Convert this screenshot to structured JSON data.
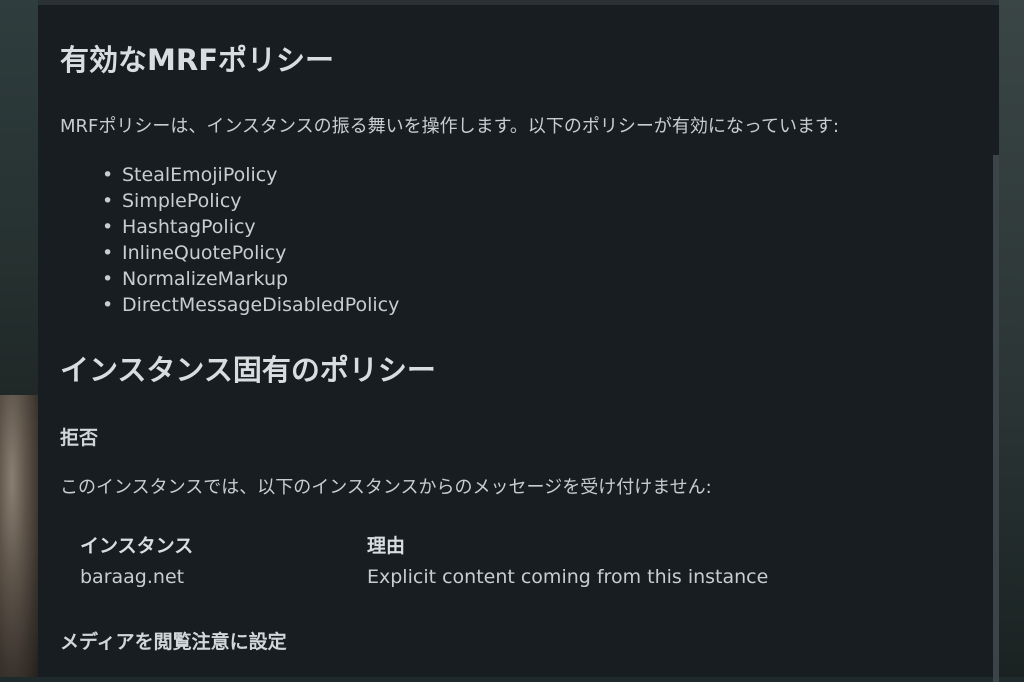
{
  "mrf": {
    "heading": "有効なMRFポリシー",
    "intro": "MRFポリシーは、インスタンスの振る舞いを操作します。以下のポリシーが有効になっています:",
    "policies": [
      "StealEmojiPolicy",
      "SimplePolicy",
      "HashtagPolicy",
      "InlineQuotePolicy",
      "NormalizeMarkup",
      "DirectMessageDisabledPolicy"
    ]
  },
  "instance": {
    "heading": "インスタンス固有のポリシー",
    "reject": {
      "heading": "拒否",
      "description": "このインスタンスでは、以下のインスタンスからのメッセージを受け付けません:",
      "table": {
        "col_instance": "インスタンス",
        "col_reason": "理由",
        "rows": [
          {
            "instance": "baraag.net",
            "reason": "Explicit content coming from this instance"
          }
        ]
      }
    },
    "media_nsfw": {
      "heading": "メディアを閲覧注意に設定"
    }
  }
}
